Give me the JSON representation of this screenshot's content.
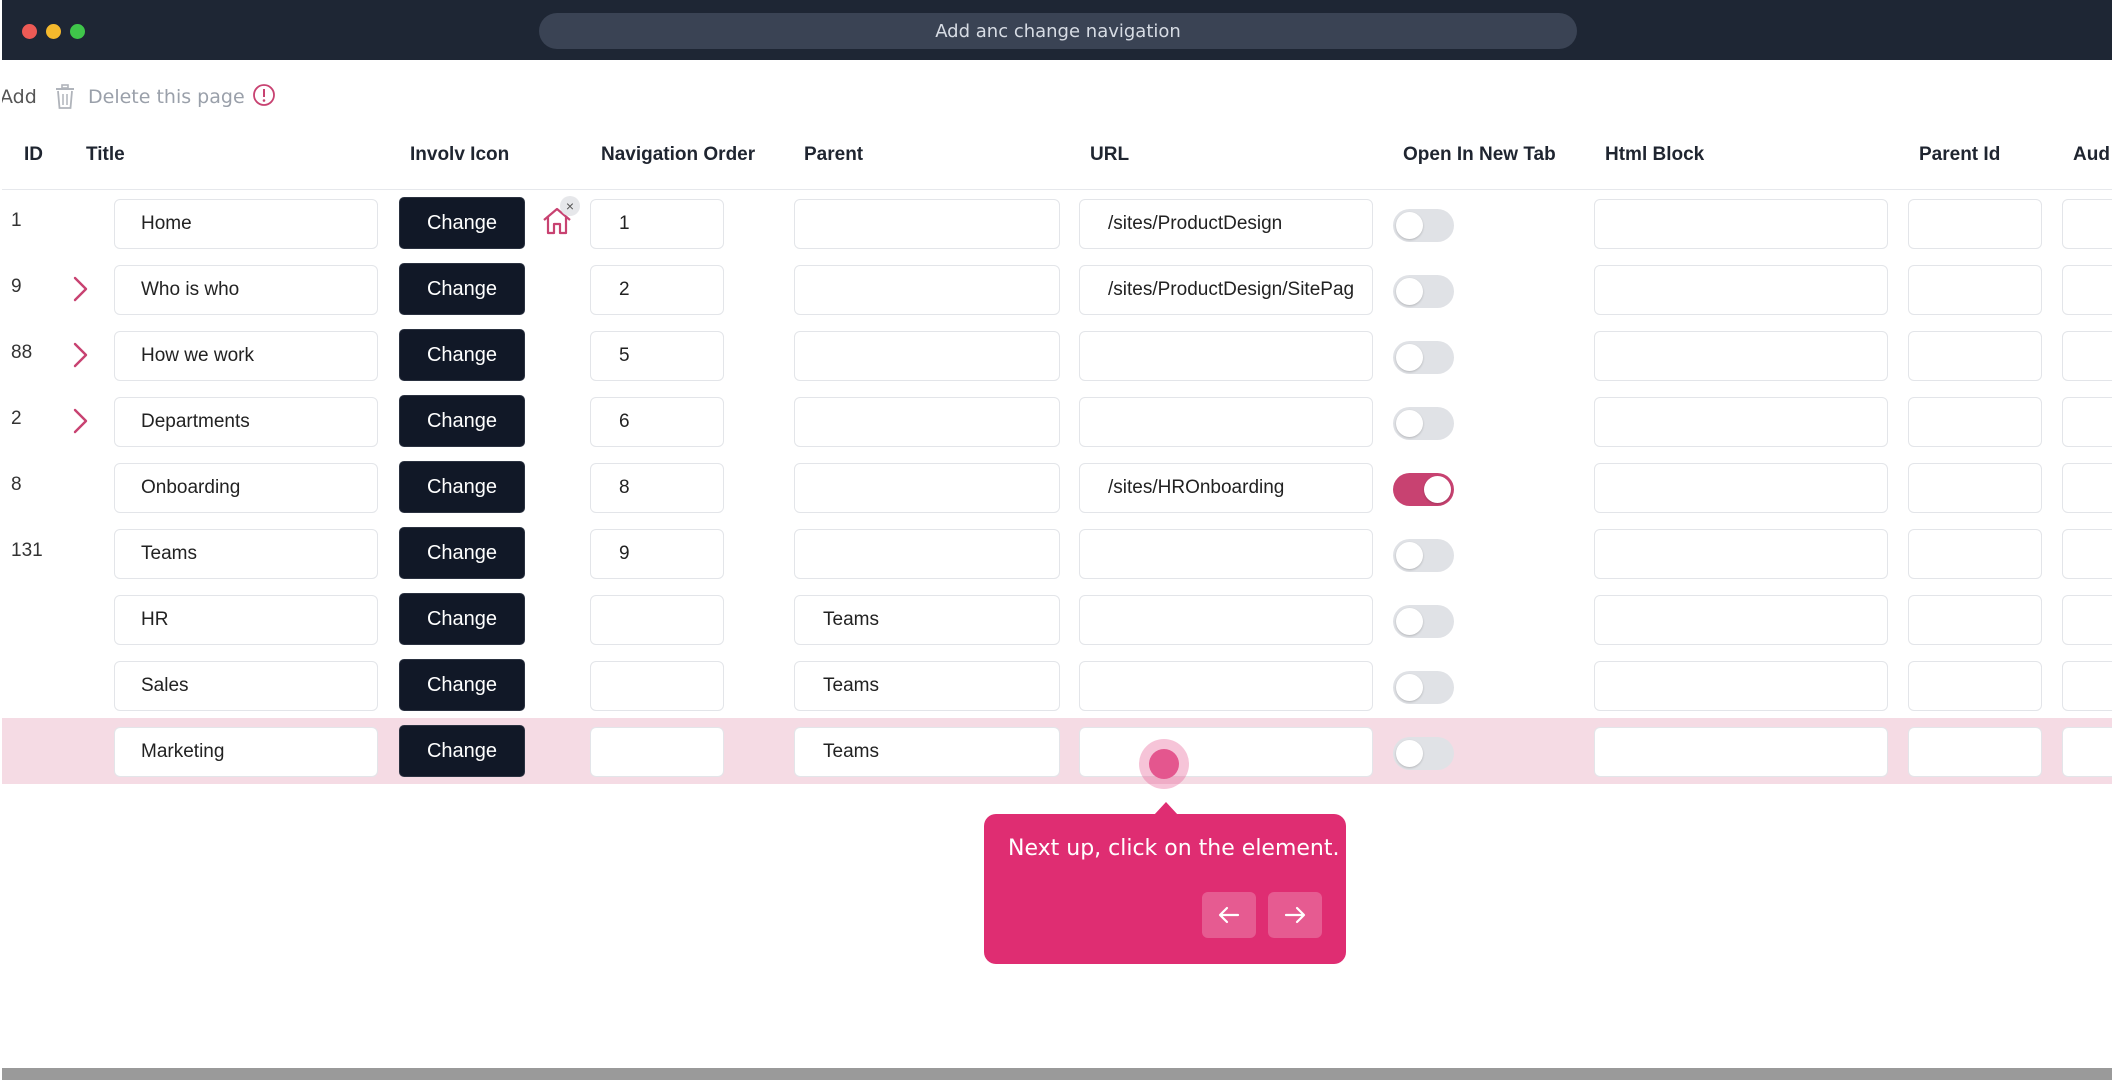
{
  "window": {
    "address_text": "Add anc change navigation"
  },
  "toolbar": {
    "add_label": "Add",
    "delete_label": "Delete this page"
  },
  "columns": {
    "id": "ID",
    "title": "Title",
    "icon": "Involv Icon",
    "order": "Navigation Order",
    "parent": "Parent",
    "url": "URL",
    "new_tab": "Open In New Tab",
    "html": "Html Block",
    "parent_id": "Parent Id",
    "audience": "Aud"
  },
  "rows": [
    {
      "id": "1",
      "title": "Home",
      "change": "Change",
      "order": "1",
      "parent": "",
      "url": "/sites/ProductDesign",
      "new_tab": false
    },
    {
      "id": "9",
      "title": "Who is who",
      "change": "Change",
      "order": "2",
      "parent": "",
      "url": "/sites/ProductDesign/SitePag",
      "new_tab": false
    },
    {
      "id": "88",
      "title": "How we work",
      "change": "Change",
      "order": "5",
      "parent": "",
      "url": "",
      "new_tab": false
    },
    {
      "id": "2",
      "title": "Departments",
      "change": "Change",
      "order": "6",
      "parent": "",
      "url": "",
      "new_tab": false
    },
    {
      "id": "8",
      "title": "Onboarding",
      "change": "Change",
      "order": "8",
      "parent": "",
      "url": "/sites/HROnboarding",
      "new_tab": true
    },
    {
      "id": "131",
      "title": "Teams",
      "change": "Change",
      "order": "9",
      "parent": "",
      "url": "",
      "new_tab": false
    },
    {
      "id": "",
      "title": "HR",
      "change": "Change",
      "order": "",
      "parent": "Teams",
      "url": "",
      "new_tab": false
    },
    {
      "id": "",
      "title": "Sales",
      "change": "Change",
      "order": "",
      "parent": "Teams",
      "url": "",
      "new_tab": false
    },
    {
      "id": "",
      "title": "Marketing",
      "change": "Change",
      "order": "",
      "parent": "Teams",
      "url": "",
      "new_tab": false
    }
  ],
  "tooltip": {
    "text": "Next up, click on the element."
  },
  "colors": {
    "accent": "#df2d72",
    "toggle_on": "#c84271",
    "button_dark": "#111827",
    "titlebar": "#1e2634"
  }
}
